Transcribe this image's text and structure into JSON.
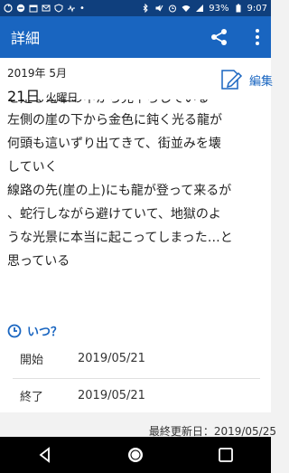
{
  "statusbar": {
    "battery": "93%",
    "time": "9:07"
  },
  "appbar": {
    "title": "詳細"
  },
  "entry": {
    "year_month": "2019年 5月",
    "day": "21日",
    "weekday": "火曜日",
    "edit_label": "編集",
    "text_partial": "を走る電車の中から見下ろしている",
    "text_lines": [
      "左側の崖の下から金色に鈍く光る龍が",
      "何頭も這いずり出てきて、街並みを壊",
      "していく",
      "線路の先(崖の上)にも龍が登って来るが",
      "、蛇行しながら避けていて、地獄のよ",
      "うな光景に本当に起こってしまった…と",
      "思っている"
    ]
  },
  "when": {
    "heading": "いつ？",
    "start_label": "開始",
    "start_value": "2019/05/21",
    "end_label": "終了",
    "end_value": "2019/05/21"
  },
  "footer": {
    "updated": "最終更新日：2019/05/25"
  },
  "colors": {
    "appbar": "#1965c0",
    "statusbar": "#0f3f7d",
    "accent": "#1965c0"
  }
}
